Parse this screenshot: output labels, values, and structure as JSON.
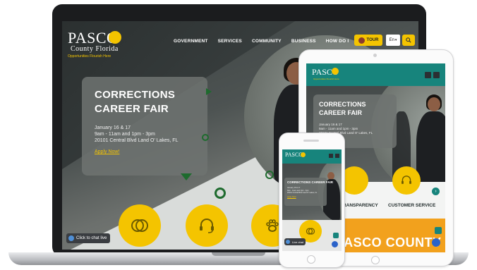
{
  "laptop": {
    "logo": {
      "word": "PASCO",
      "sub": "County Florida",
      "tagline": "Opportunities Flourish Here"
    },
    "nav": [
      "GOVERNMENT",
      "SERVICES",
      "COMMUNITY",
      "BUSINESS",
      "HOW DO I"
    ],
    "tour_label": "TOUR",
    "lang_label": "En",
    "event": {
      "title": "CORRECTIONS CAREER FAIR",
      "dates": "January 16 & 17",
      "times": "9am - 11am and 1pm - 3pm",
      "address": "20101 Central Blvd Land O' Lakes, FL",
      "link": "Apply Now!"
    },
    "chat_label": "Click to chat live",
    "tiles": [
      "transparency-icon",
      "headset-icon",
      "paw-icon"
    ]
  },
  "tablet": {
    "logo": {
      "word": "PASCO",
      "tagline": "Opportunities Flourish Here"
    },
    "event": {
      "title": "CORRECTIONS CAREER FAIR",
      "dates": "January 16 & 17",
      "times": "9am - 11am and 1pm - 3pm",
      "address": "20101 Central Blvd Land O' Lakes, FL"
    },
    "tile_labels": [
      "TRANSPARENCY",
      "CUSTOMER SERVICE"
    ],
    "banner": "PASCO COUNTY"
  },
  "phone": {
    "logo": {
      "word": "PASCO"
    },
    "event": {
      "title": "CORRECTIONS CAREER FAIR",
      "dates": "January 16 & 17",
      "times": "9am - 11am and 1pm - 3pm",
      "address": "20101 Central Blvd Land O' Lakes, FL",
      "link": "Apply Now!"
    },
    "chat_label": "Live chat"
  },
  "colors": {
    "brand_yellow": "#f4c400",
    "brand_teal": "#17847c",
    "brand_green": "#1e6b2e",
    "orange": "#f2a11d"
  }
}
